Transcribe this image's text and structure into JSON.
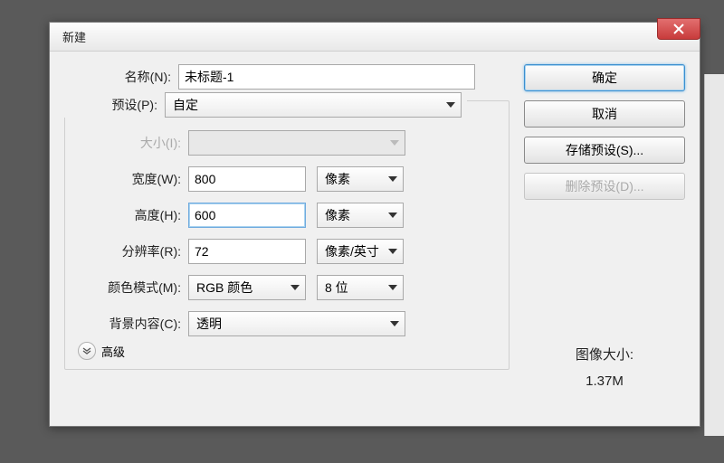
{
  "titlebar": {
    "title": "新建"
  },
  "labels": {
    "name": "名称(N):",
    "preset": "预设(P):",
    "size": "大小(I):",
    "width": "宽度(W):",
    "height": "高度(H):",
    "resolution": "分辨率(R):",
    "colormode": "颜色模式(M):",
    "background": "背景内容(C):",
    "advanced": "高级"
  },
  "values": {
    "name": "未标题-1",
    "preset": "自定",
    "size": "",
    "width": "800",
    "height": "600",
    "resolution": "72",
    "colormode": "RGB 颜色",
    "bitdepth": "8 位",
    "background": "透明"
  },
  "units": {
    "width": "像素",
    "height": "像素",
    "resolution": "像素/英寸"
  },
  "buttons": {
    "ok": "确定",
    "cancel": "取消",
    "savepreset": "存储预设(S)...",
    "deletepreset": "删除预设(D)..."
  },
  "imagesize": {
    "label": "图像大小:",
    "value": "1.37M"
  }
}
